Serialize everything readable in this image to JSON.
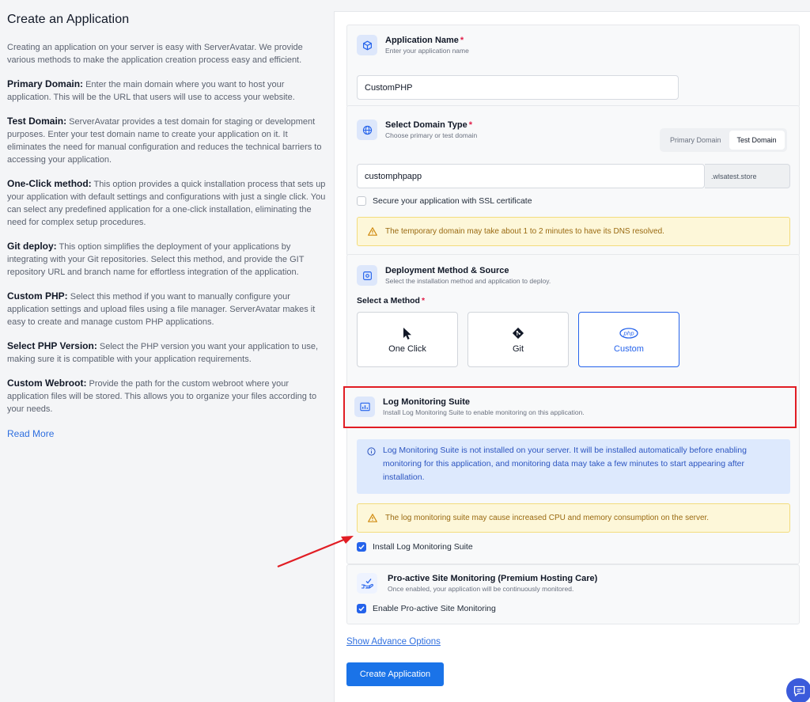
{
  "left": {
    "title": "Create an Application",
    "intro": "Creating an application on your server is easy with ServerAvatar. We provide various methods to make the application creation process easy and efficient.",
    "sections": [
      {
        "term": "Primary Domain:",
        "text": " Enter the main domain where you want to host your application. This will be the URL that users will use to access your website."
      },
      {
        "term": "Test Domain:",
        "text": " ServerAvatar provides a test domain for staging or development purposes. Enter your test domain name to create your application on it. It eliminates the need for manual configuration and reduces the technical barriers to accessing your application."
      },
      {
        "term": "One-Click method:",
        "text": " This option provides a quick installation process that sets up your application with default settings and configurations with just a single click. You can select any predefined application for a one-click installation, eliminating the need for complex setup procedures."
      },
      {
        "term": "Git deploy:",
        "text": " This option simplifies the deployment of your applications by integrating with your Git repositories. Select this method, and provide the GIT repository URL and branch name for effortless integration of the application."
      },
      {
        "term": "Custom PHP:",
        "text": " Select this method if you want to manually configure your application settings and upload files using a file manager. ServerAvatar makes it easy to create and manage custom PHP applications."
      },
      {
        "term": "Select PHP Version:",
        "text": " Select the PHP version you want your application to use, making sure it is compatible with your application requirements."
      },
      {
        "term": "Custom Webroot:",
        "text": " Provide the path for the custom webroot where your application files will be stored. This allows you to organize your files according to your needs."
      }
    ],
    "read_more": "Read More"
  },
  "app_name": {
    "title": "Application Name",
    "required": "*",
    "subtitle": "Enter your application name",
    "value": "CustomPHP"
  },
  "domain": {
    "title": "Select Domain Type",
    "required": "*",
    "subtitle": "Choose primary or test domain",
    "toggle": [
      "Primary Domain",
      "Test Domain"
    ],
    "selected": "Test Domain",
    "value": "customphpapp",
    "suffix": ".wlsatest.store",
    "ssl_label": "Secure your application with SSL certificate",
    "ssl_checked": false,
    "warning": "The temporary domain may take about 1 to 2 minutes to have its DNS resolved."
  },
  "deployment": {
    "title": "Deployment Method & Source",
    "subtitle": "Select the installation method and application to deploy.",
    "method_label": "Select a Method",
    "required": "*",
    "methods": [
      {
        "label": "One Click",
        "icon": "cursor-icon"
      },
      {
        "label": "Git",
        "icon": "git-icon"
      },
      {
        "label": "Custom",
        "icon": "php-icon"
      }
    ],
    "selected": "Custom"
  },
  "log_monitoring": {
    "title": "Log Monitoring Suite",
    "subtitle": "Install Log Monitoring Suite to enable monitoring on this application.",
    "info": "Log Monitoring Suite is not installed on your server. It will be installed automatically before enabling monitoring for this application, and monitoring data may take a few minutes to start appearing after installation.",
    "warning": "The log monitoring suite may cause increased CPU and memory consumption on the server.",
    "install_label": "Install Log Monitoring Suite",
    "install_checked": true
  },
  "proactive": {
    "title": "Pro-active Site Monitoring (Premium Hosting Care)",
    "subtitle": "Once enabled, your application will be continuously monitored.",
    "enable_label": "Enable Pro-active Site Monitoring",
    "enable_checked": true
  },
  "actions": {
    "advance_options": "Show Advance Options",
    "create": "Create Application"
  },
  "colors": {
    "accent": "#2563eb",
    "highlight_border": "#e11d24",
    "annotation_arrow": "#e11d24"
  }
}
